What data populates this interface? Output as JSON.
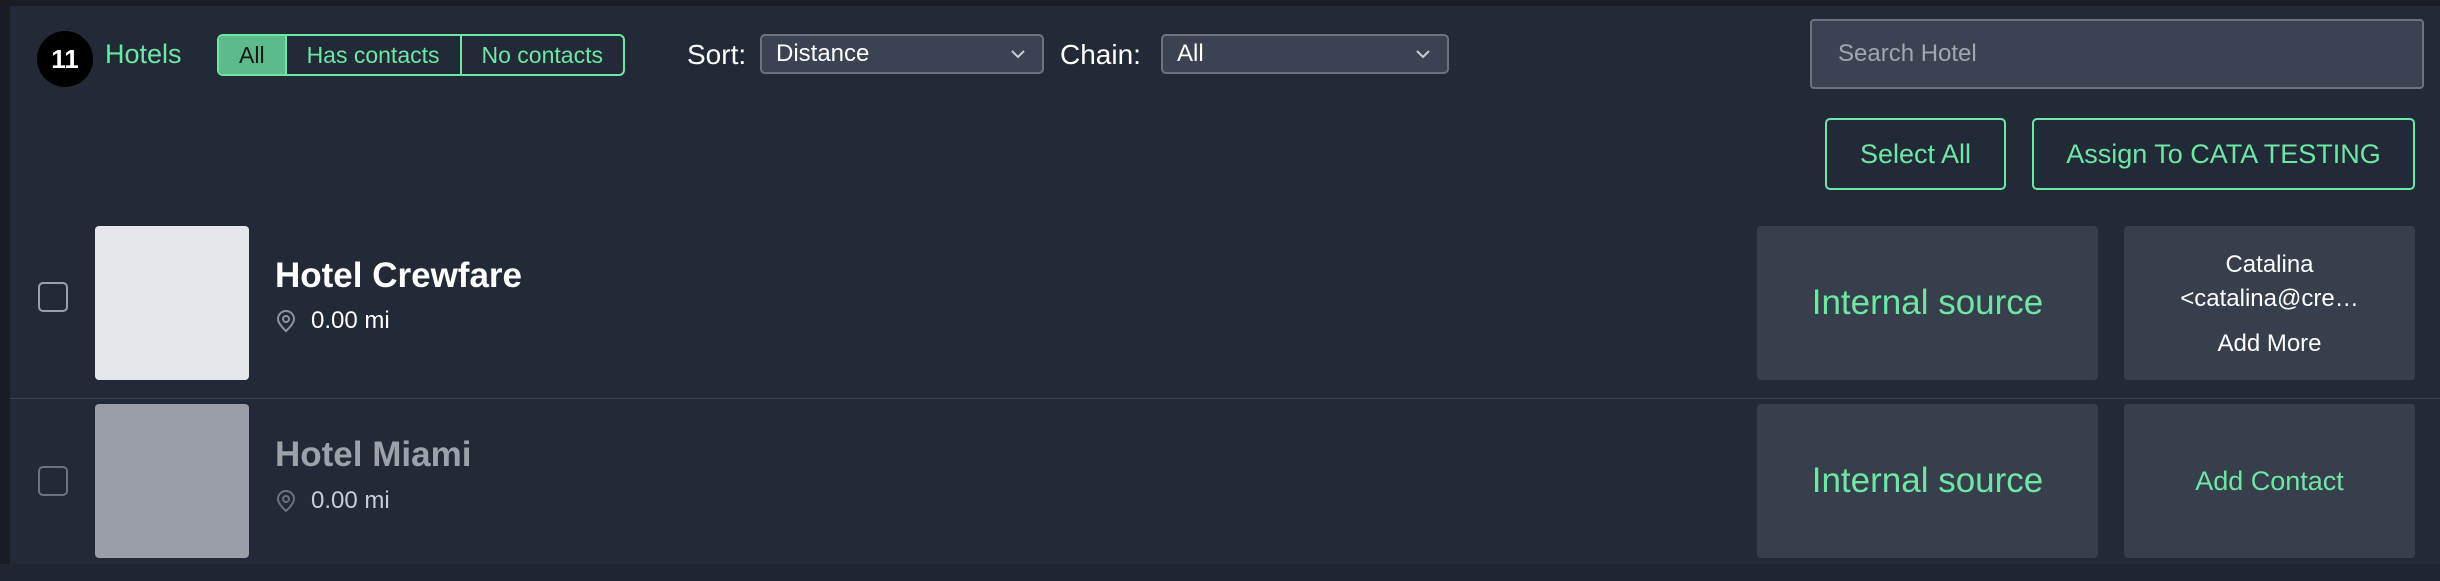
{
  "header": {
    "hotel_count": "11",
    "hotels_label": "Hotels",
    "filters": [
      {
        "label": "All",
        "active": true
      },
      {
        "label": "Has contacts",
        "active": false
      },
      {
        "label": "No contacts",
        "active": false
      }
    ],
    "sort_label": "Sort:",
    "sort_value": "Distance",
    "chain_label": "Chain:",
    "chain_value": "All",
    "search_placeholder": "Search Hotel"
  },
  "actions": {
    "select_all": "Select All",
    "assign": "Assign To CATA TESTING"
  },
  "hotels": [
    {
      "name": "Hotel Crewfare",
      "distance": "0.00 mi",
      "source": "Internal source",
      "contact_name": "Catalina",
      "contact_email": "<catalina@cre…",
      "add_more": "Add More"
    },
    {
      "name": "Hotel Miami",
      "distance": "0.00 mi",
      "source": "Internal source",
      "add_contact": "Add Contact"
    }
  ],
  "colors": {
    "accent": "#6ee7a5",
    "background": "#232a37",
    "tile": "#373e4c"
  }
}
